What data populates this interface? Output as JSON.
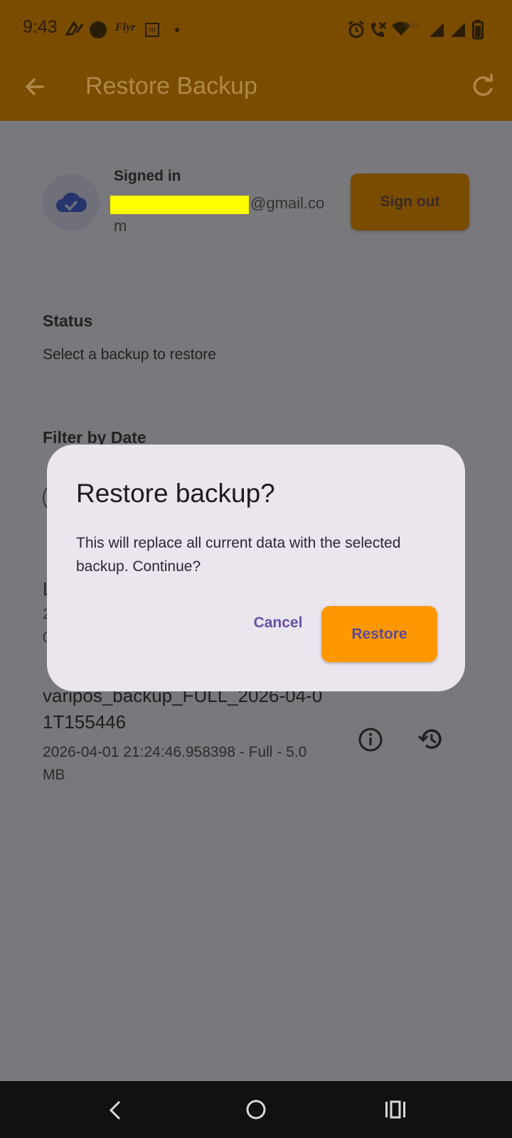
{
  "status_bar": {
    "time": "9:43",
    "carrier_label": "Flyr",
    "network": "5G+"
  },
  "app_bar": {
    "title": "Restore Backup"
  },
  "account": {
    "signed_in_label": "Signed in",
    "email_visible_part": "@gmail.co",
    "email_wrap": "m",
    "sign_out_label": "Sign out"
  },
  "status": {
    "heading": "Status",
    "text": "Select a backup to restore"
  },
  "filter": {
    "heading": "Filter by Date"
  },
  "partial_item": {
    "title_char": "L",
    "line1_char": "2",
    "line2_char": "0"
  },
  "backup_item": {
    "name": "varipos_backup_FULL_2026-04-01T155446",
    "meta": "2026-04-01 21:24:46.958398 - Full - 5.0 MB"
  },
  "dialog": {
    "title": "Restore backup?",
    "message": "This will replace all current data with the selected backup. Continue?",
    "cancel_label": "Cancel",
    "confirm_label": "Restore"
  },
  "colors": {
    "accent": "#ff9800",
    "dialog_bg": "#ebe5ee",
    "primary_text": "#6750a4",
    "scrim": "#79787c"
  }
}
